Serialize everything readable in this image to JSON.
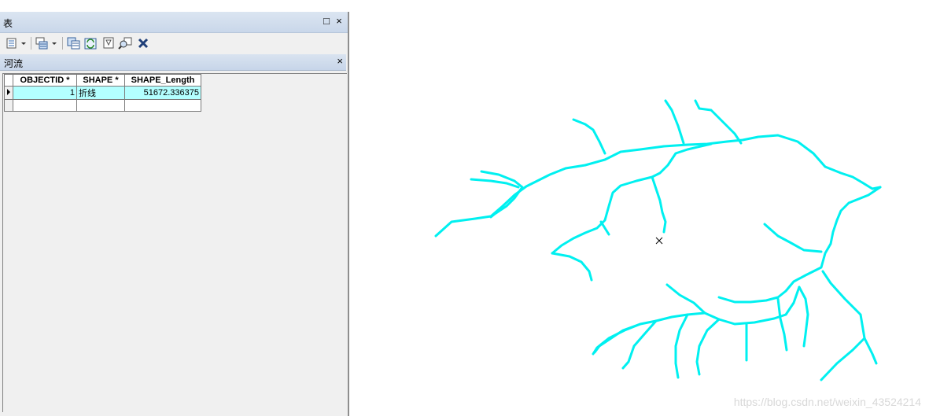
{
  "window": {
    "title": "表",
    "restore_glyph": "□",
    "close_glyph": "×"
  },
  "toolbar": {
    "icons": [
      "table-options-icon",
      "related-tables-icon",
      "select-by-attributes-icon",
      "switch-selection-icon",
      "clear-selection-icon",
      "zoom-to-selected-icon",
      "delete-selected-icon"
    ]
  },
  "tab": {
    "label": "河流",
    "close_glyph": "×"
  },
  "table": {
    "columns": [
      "OBJECTID *",
      "SHAPE *",
      "SHAPE_Length"
    ],
    "rows": [
      {
        "objectid": "1",
        "shape": "折线",
        "length": "51672.336375"
      }
    ]
  },
  "colors": {
    "river": "#00f0f0",
    "selection": "#b3ffff",
    "title_bar": "#c9d7ea"
  },
  "map": {
    "layer": "河流",
    "marker_glyph": "×"
  },
  "watermark": "https://blog.csdn.net/weixin_43524214"
}
